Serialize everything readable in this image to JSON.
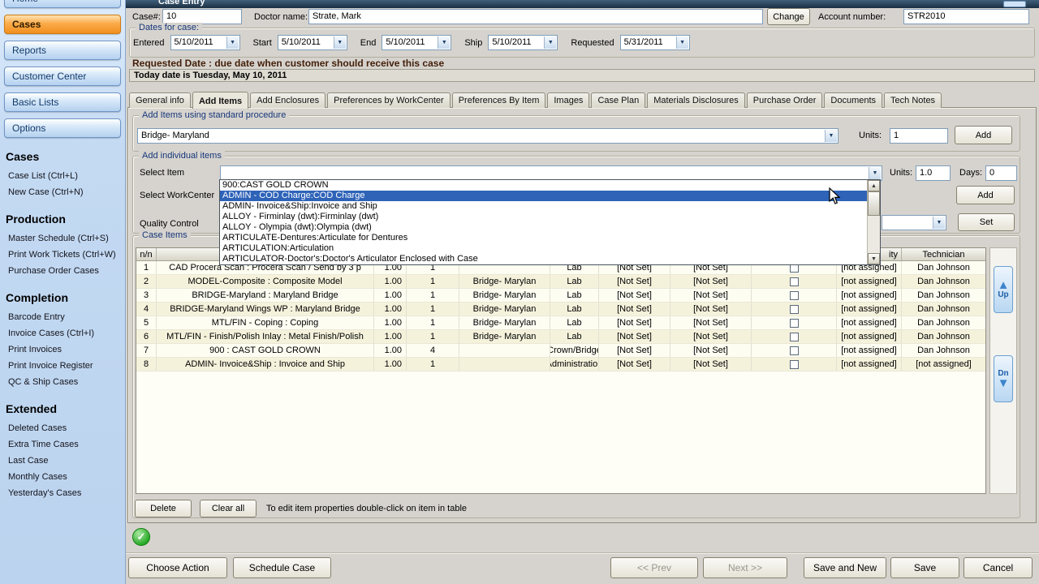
{
  "titlebar": {
    "title": "Case Entry"
  },
  "icons": {
    "check": "✓",
    "dropdown_arrow": "▼",
    "up_arrow": "▲",
    "down_arrow": "▼"
  },
  "sidebar": {
    "nav": [
      {
        "label": "Home",
        "active": false
      },
      {
        "label": "Cases",
        "active": true
      },
      {
        "label": "Reports",
        "active": false
      },
      {
        "label": "Customer Center",
        "active": false
      },
      {
        "label": "Basic Lists",
        "active": false
      },
      {
        "label": "Options",
        "active": false
      }
    ],
    "sections": [
      {
        "title": "Cases",
        "items": [
          "Case List (Ctrl+L)",
          "New Case (Ctrl+N)"
        ]
      },
      {
        "title": "Production",
        "items": [
          "Master Schedule (Ctrl+S)",
          "Print Work Tickets (Ctrl+W)",
          "Purchase Order Cases"
        ]
      },
      {
        "title": "Completion",
        "items": [
          "Barcode Entry",
          "Invoice Cases (Ctrl+I)",
          "Print Invoices",
          "Print Invoice Register",
          "QC & Ship Cases"
        ]
      },
      {
        "title": "Extended",
        "items": [
          "Deleted Cases",
          "Extra Time Cases",
          "Last Case",
          "Monthly Cases",
          "Yesterday's Cases"
        ]
      }
    ]
  },
  "header": {
    "case_label": "Case#:",
    "case_value": "10",
    "doctor_label": "Doctor name:",
    "doctor_value": "Strate, Mark",
    "change_button": "Change",
    "account_label": "Account number:",
    "account_value": "STR2010"
  },
  "dates": {
    "group_title": "Dates for case:",
    "fields": [
      {
        "label": "Entered",
        "value": "5/10/2011"
      },
      {
        "label": "Start",
        "value": "5/10/2011"
      },
      {
        "label": "End",
        "value": "5/10/2011"
      },
      {
        "label": "Ship",
        "value": "5/10/2011"
      },
      {
        "label": "Requested",
        "value": "5/31/2011"
      }
    ],
    "note": "Requested Date : due date when customer should receive this case",
    "today": "Today date is Tuesday, May 10, 2011"
  },
  "tabs": [
    {
      "label": "General info",
      "active": false
    },
    {
      "label": "Add Items",
      "active": true
    },
    {
      "label": "Add Enclosures",
      "active": false
    },
    {
      "label": "Preferences by WorkCenter",
      "active": false
    },
    {
      "label": "Preferences By Item",
      "active": false
    },
    {
      "label": "Images",
      "active": false
    },
    {
      "label": "Case Plan",
      "active": false
    },
    {
      "label": "Materials Disclosures",
      "active": false
    },
    {
      "label": "Purchase Order",
      "active": false
    },
    {
      "label": "Documents",
      "active": false
    },
    {
      "label": "Tech Notes",
      "active": false
    }
  ],
  "standard_procedure": {
    "group_title": "Add Items using standard procedure",
    "value": "Bridge- Maryland",
    "units_label": "Units:",
    "units_value": "1",
    "add_button": "Add"
  },
  "individual_items": {
    "group_title": "Add individual items",
    "select_item_label": "Select Item",
    "select_workcenter_label": "Select WorkCenter",
    "quality_control_label": "Quality Control",
    "units_label": "Units:",
    "units_value": "1.0",
    "days_label": "Days:",
    "days_value": "0",
    "add_button": "Add",
    "set_button": "Set",
    "dropdown": {
      "items": [
        {
          "label": "900:CAST GOLD CROWN",
          "selected": false
        },
        {
          "label": "ADMIN - COD Charge:COD Charge",
          "selected": true
        },
        {
          "label": "ADMIN- Invoice&Ship:Invoice and Ship",
          "selected": false
        },
        {
          "label": "ALLOY - Firminlay (dwt):Firminlay (dwt)",
          "selected": false
        },
        {
          "label": "ALLOY - Olympia (dwt):Olympia (dwt)",
          "selected": false
        },
        {
          "label": "ARTICULATE-Dentures:Articulate for Dentures",
          "selected": false
        },
        {
          "label": "ARTICULATION:Articulation",
          "selected": false
        },
        {
          "label": "ARTICULATOR-Doctor's:Doctor's Articulator Enclosed with Case",
          "selected": false
        }
      ]
    }
  },
  "case_items": {
    "group_title": "Case Items",
    "headers": [
      "n/n",
      "",
      "",
      "",
      "",
      "",
      "",
      "",
      "",
      "ity",
      "Technician"
    ],
    "rows": [
      {
        "n": "1",
        "item": "CAD Procera Scan : Procera Scan / Send by 3 p",
        "units": "1.00",
        "qty": "1",
        "proc": "",
        "wc": "Lab",
        "s1": "[Not Set]",
        "s2": "[Not Set]",
        "t1": "[not assigned]",
        "t2": "Dan Johnson"
      },
      {
        "n": "2",
        "item": "MODEL-Composite : Composite Model",
        "units": "1.00",
        "qty": "1",
        "proc": "Bridge- Marylan",
        "wc": "Lab",
        "s1": "[Not Set]",
        "s2": "[Not Set]",
        "t1": "[not assigned]",
        "t2": "Dan Johnson"
      },
      {
        "n": "3",
        "item": "BRIDGE-Maryland : Maryland Bridge",
        "units": "1.00",
        "qty": "1",
        "proc": "Bridge- Marylan",
        "wc": "Lab",
        "s1": "[Not Set]",
        "s2": "[Not Set]",
        "t1": "[not assigned]",
        "t2": "Dan Johnson"
      },
      {
        "n": "4",
        "item": "BRIDGE-Maryland Wings WP : Maryland Bridge",
        "units": "1.00",
        "qty": "1",
        "proc": "Bridge- Marylan",
        "wc": "Lab",
        "s1": "[Not Set]",
        "s2": "[Not Set]",
        "t1": "[not assigned]",
        "t2": "Dan Johnson"
      },
      {
        "n": "5",
        "item": "MTL/FIN - Coping : Coping",
        "units": "1.00",
        "qty": "1",
        "proc": "Bridge- Marylan",
        "wc": "Lab",
        "s1": "[Not Set]",
        "s2": "[Not Set]",
        "t1": "[not assigned]",
        "t2": "Dan Johnson"
      },
      {
        "n": "6",
        "item": "MTL/FIN - Finish/Polish Inlay : Metal Finish/Polish",
        "units": "1.00",
        "qty": "1",
        "proc": "Bridge- Marylan",
        "wc": "Lab",
        "s1": "[Not Set]",
        "s2": "[Not Set]",
        "t1": "[not assigned]",
        "t2": "Dan Johnson"
      },
      {
        "n": "7",
        "item": "900 : CAST GOLD CROWN",
        "units": "1.00",
        "qty": "4",
        "proc": "",
        "wc": "Crown/Bridge",
        "s1": "[Not Set]",
        "s2": "[Not Set]",
        "t1": "[not assigned]",
        "t2": "Dan Johnson"
      },
      {
        "n": "8",
        "item": "ADMIN- Invoice&Ship : Invoice and Ship",
        "units": "1.00",
        "qty": "1",
        "proc": "",
        "wc": "Administration",
        "s1": "[Not Set]",
        "s2": "[Not Set]",
        "t1": "[not assigned]",
        "t2": "[not assigned]"
      }
    ],
    "up_button": "Up",
    "down_button": "Dn",
    "delete_button": "Delete",
    "clear_button": "Clear all",
    "hint": "To edit item properties double-click on item in table"
  },
  "footer": {
    "choose_action": "Choose Action",
    "schedule_case": "Schedule Case",
    "prev": "<< Prev",
    "next": "Next >>",
    "save_and_new": "Save and New",
    "save": "Save",
    "cancel": "Cancel"
  }
}
